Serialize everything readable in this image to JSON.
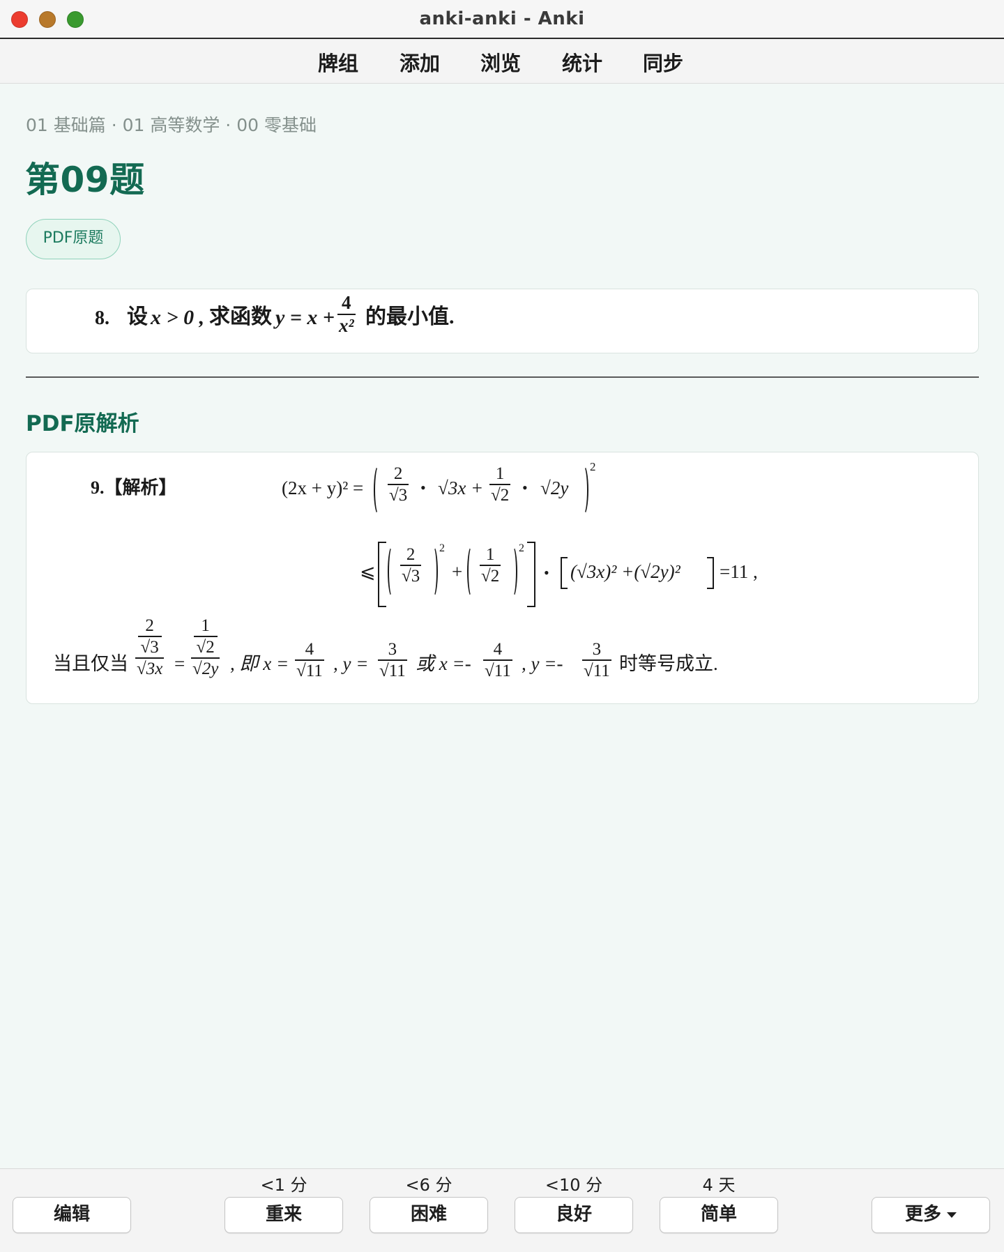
{
  "window": {
    "title": "anki-anki - Anki"
  },
  "toolbar": {
    "items": [
      "牌组",
      "添加",
      "浏览",
      "统计",
      "同步"
    ]
  },
  "card": {
    "breadcrumb": "01 基础篇 · 01 高等数学 · 00 零基础",
    "title": "第09题",
    "pdf_button": "PDF原题",
    "question": {
      "number": "8.",
      "text_pre": "设",
      "condition": "x > 0 ,",
      "text_mid": "求函数",
      "expr": "y = x +",
      "frac_num": "4",
      "frac_den": "x²",
      "text_post": "的最小值."
    },
    "analysis_heading": "PDF原解析",
    "analysis": {
      "label": "9.【解析】",
      "line1": {
        "lhs": "(2x + y)² =",
        "f1_num": "2",
        "f1_den": "√3",
        "dot": "•",
        "t1": "√3x +",
        "f2_num": "1",
        "f2_den": "√2",
        "t2": "√2y",
        "exp": "2"
      },
      "line2": {
        "le": "⩽",
        "f1_num": "2",
        "f1_den": "√3",
        "plus": "+",
        "f2_num": "1",
        "f2_den": "√2",
        "exp": "2",
        "dot": "•",
        "inner": "(√3x)² +(√2y)²",
        "result": "=11 ,"
      },
      "line3": {
        "pre": "当且仅当",
        "f_num_top": "2",
        "f_num_bot": "√3",
        "f_den": "√3x",
        "eq": "=",
        "g_num_top": "1",
        "g_num_bot": "√2",
        "g_den": "√2y",
        "t1": ", 即 x =",
        "a_num": "4",
        "a_den": "√11",
        "t2": ", y =",
        "b_num": "3",
        "b_den": "√11",
        "t3": "或 x =-",
        "c_num": "4",
        "c_den": "√11",
        "t4": ", y =-",
        "d_num": "3",
        "d_den": "√11",
        "post": "时等号成立."
      }
    }
  },
  "answer_buttons": {
    "edit": "编辑",
    "again": {
      "label": "重来",
      "due": "<1 分"
    },
    "hard": {
      "label": "困难",
      "due": "<6 分"
    },
    "good": {
      "label": "良好",
      "due": "<10 分"
    },
    "easy": {
      "label": "简单",
      "due": "4 天"
    },
    "more": "更多"
  },
  "colors": {
    "accent": "#136a52",
    "background": "#f2f8f6",
    "pill_border": "#8fd2ba",
    "close": "#ec3c2f",
    "minimize": "#b8792b",
    "maximize": "#3a9a2f"
  }
}
